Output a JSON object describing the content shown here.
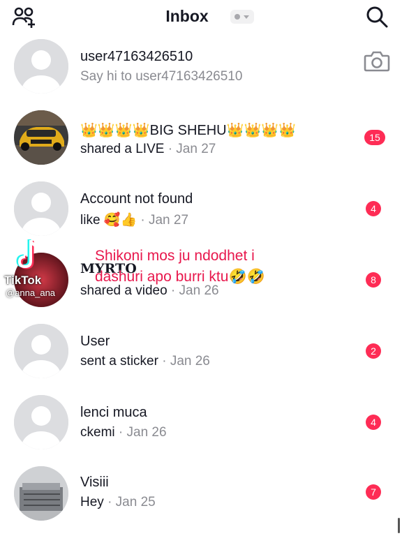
{
  "header": {
    "title": "Inbox"
  },
  "conversations": [
    {
      "name": "user47163426510",
      "preview": "Say hi to user47163426510",
      "date": "",
      "badge": ""
    },
    {
      "name": "👑👑👑👑BIG SHEHU👑👑👑👑",
      "preview": "shared a LIVE",
      "date": " · Jan 27",
      "badge": "15"
    },
    {
      "name": "Account not found",
      "preview": "like 🥰👍",
      "date": " · Jan 27",
      "badge": "4"
    },
    {
      "name": "MYRTO",
      "preview": "shared a video",
      "date": " · Jan 26",
      "badge": "8"
    },
    {
      "name": "User",
      "preview": "sent a sticker",
      "date": " · Jan 26",
      "badge": "2"
    },
    {
      "name": "lenci muca",
      "preview": "ckemi",
      "date": " · Jan 26",
      "badge": "4"
    },
    {
      "name": "Visiii",
      "preview": "Hey",
      "date": " · Jan 25",
      "badge": "7"
    }
  ],
  "overlay": {
    "line1": "Shikoni mos ju ndodhet i",
    "line2": "dashuri apo burri ktu🤣🤣"
  },
  "watermark": {
    "brand": "TikTok",
    "handle": "@anna_ana"
  },
  "colors": {
    "badge": "#fe2c55",
    "overlay_text": "#e8174c"
  },
  "icons": {
    "header_left": "add-friends-icon",
    "header_right": "search-icon",
    "row_action": "camera-icon"
  }
}
